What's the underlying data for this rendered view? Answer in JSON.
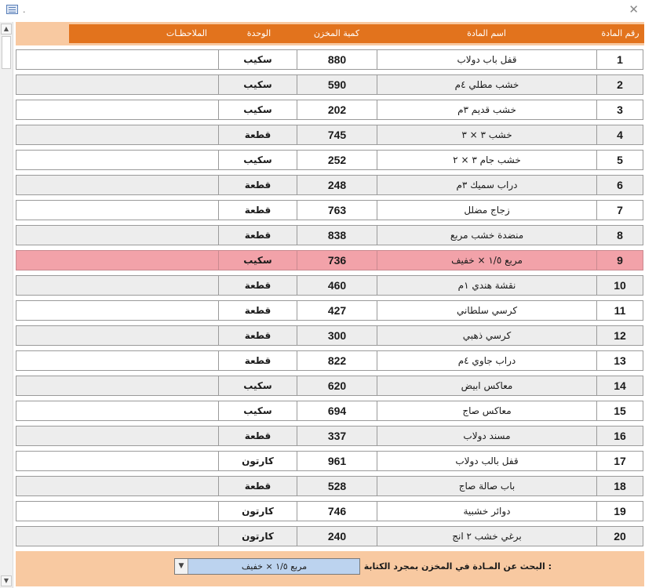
{
  "window": {
    "title": "."
  },
  "header": {
    "item_number": "رقم المادة",
    "item_name": "اسم المادة",
    "stock_qty": "كمية المخزن",
    "unit": "الوحدة",
    "notes": "الملاحظـات"
  },
  "rows": [
    {
      "num": "1",
      "name": "قفل باب دولاب",
      "qty": "880",
      "unit": "سكيب",
      "notes": ""
    },
    {
      "num": "2",
      "name": "خشب مطلي ٤م",
      "qty": "590",
      "unit": "سكيب",
      "notes": ""
    },
    {
      "num": "3",
      "name": "خشب قديم ٣م",
      "qty": "202",
      "unit": "سكيب",
      "notes": ""
    },
    {
      "num": "4",
      "name": "خشب ٣ × ٣",
      "qty": "745",
      "unit": "قطعة",
      "notes": ""
    },
    {
      "num": "5",
      "name": "خشب جام ٣ × ٢",
      "qty": "252",
      "unit": "سكيب",
      "notes": ""
    },
    {
      "num": "6",
      "name": "دراب سميك ٣م",
      "qty": "248",
      "unit": "قطعة",
      "notes": ""
    },
    {
      "num": "7",
      "name": "زجاج مضلل",
      "qty": "763",
      "unit": "قطعة",
      "notes": ""
    },
    {
      "num": "8",
      "name": "منضدة خشب مربع",
      "qty": "838",
      "unit": "قطعة",
      "notes": ""
    },
    {
      "num": "9",
      "name": "مربع ١/٥ × خفيف",
      "qty": "736",
      "unit": "سكيب",
      "notes": ""
    },
    {
      "num": "10",
      "name": "نقشة هندي ١م",
      "qty": "460",
      "unit": "قطعة",
      "notes": ""
    },
    {
      "num": "11",
      "name": "كرسي سلطاني",
      "qty": "427",
      "unit": "قطعة",
      "notes": ""
    },
    {
      "num": "12",
      "name": "كرسي ذهبي",
      "qty": "300",
      "unit": "قطعة",
      "notes": ""
    },
    {
      "num": "13",
      "name": "دراب جاوي ٤م",
      "qty": "822",
      "unit": "قطعة",
      "notes": ""
    },
    {
      "num": "14",
      "name": "معاكس ابيض",
      "qty": "620",
      "unit": "سكيب",
      "notes": ""
    },
    {
      "num": "15",
      "name": "معاكس صاج",
      "qty": "694",
      "unit": "سكيب",
      "notes": ""
    },
    {
      "num": "16",
      "name": "مسند دولاب",
      "qty": "337",
      "unit": "قطعة",
      "notes": ""
    },
    {
      "num": "17",
      "name": "قفل بالب دولاب",
      "qty": "961",
      "unit": "كارتون",
      "notes": ""
    },
    {
      "num": "18",
      "name": "باب صالة صاج",
      "qty": "528",
      "unit": "قطعة",
      "notes": ""
    },
    {
      "num": "19",
      "name": "دوائر خشبية",
      "qty": "746",
      "unit": "كارتون",
      "notes": ""
    },
    {
      "num": "20",
      "name": "برغي خشب ٢ انج",
      "qty": "240",
      "unit": "كارتون",
      "notes": ""
    }
  ],
  "selected_row_num": "9",
  "search": {
    "label": "البحث عن المـادة في المخزن بمجرد الكتابة :",
    "value": "مربع ١/٥ × خفيف"
  },
  "colors": {
    "header_accent": "#e2731d",
    "header_band": "#f8c9a1",
    "selected_row": "#f2a2a9",
    "alt_row": "#ededed",
    "search_field": "#bcd3ef"
  },
  "icons": {
    "app": "form-icon",
    "close": "close-icon",
    "scroll_up": "arrow-up-icon",
    "scroll_down": "arrow-down-icon",
    "dropdown": "chevron-down-icon"
  }
}
